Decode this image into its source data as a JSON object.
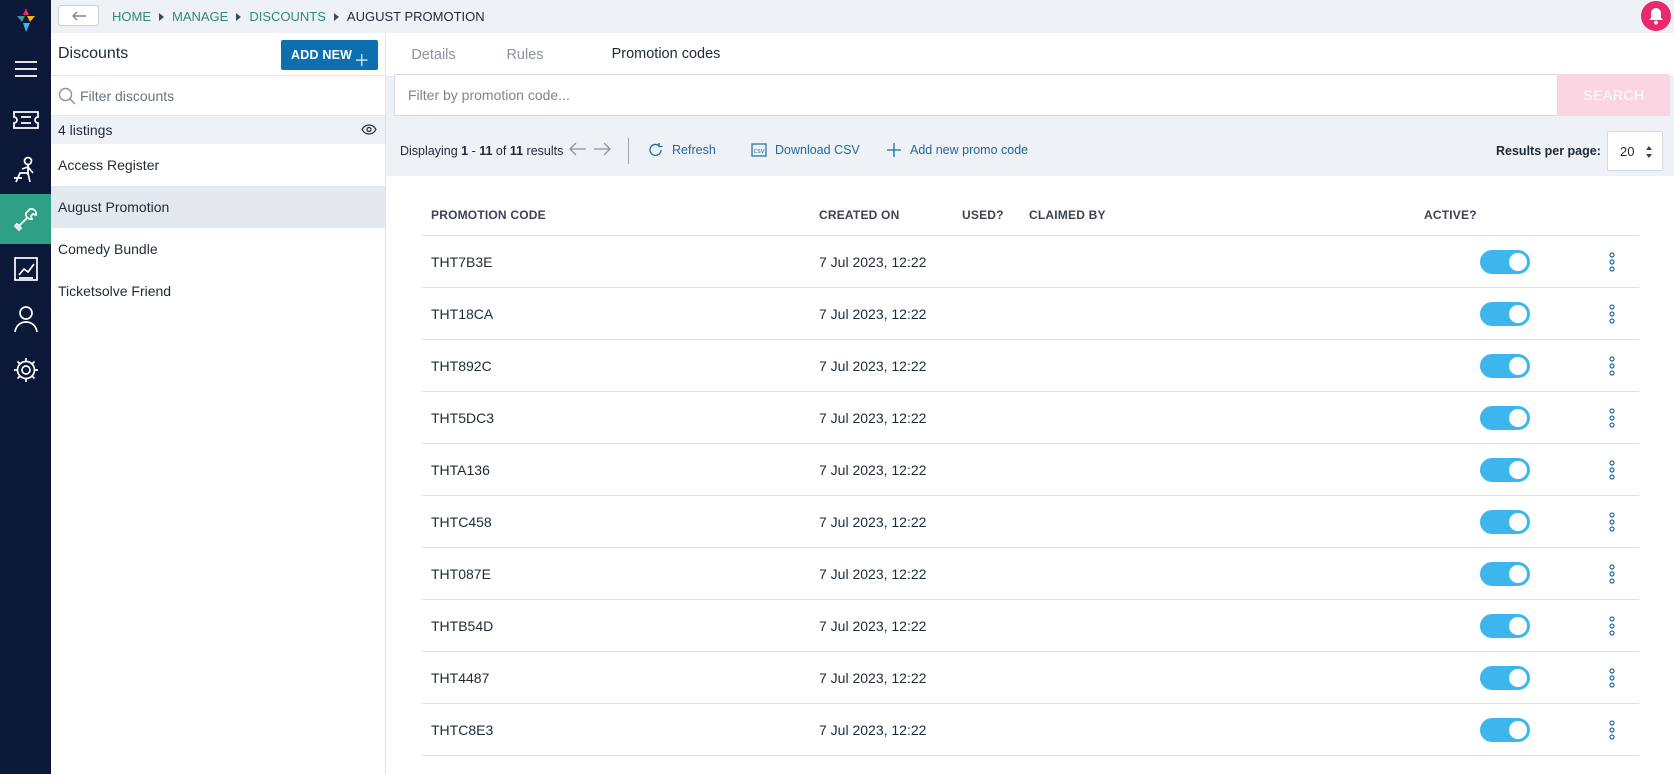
{
  "breadcrumb": [
    {
      "label": "HOME"
    },
    {
      "label": "MANAGE"
    },
    {
      "label": "DISCOUNTS"
    },
    {
      "label": "AUGUST PROMOTION"
    }
  ],
  "sidebar_nav": [
    "menu-icon",
    "ticket-icon",
    "usher-icon",
    "wrench-icon",
    "report-icon",
    "user-icon",
    "gear-icon"
  ],
  "panel": {
    "title": "Discounts",
    "add_new_label": "ADD NEW",
    "filter_placeholder": "Filter discounts",
    "listings_count": "4 listings",
    "items": [
      {
        "label": "Access Register"
      },
      {
        "label": "August Promotion"
      },
      {
        "label": "Comedy Bundle"
      },
      {
        "label": "Ticketsolve Friend"
      }
    ],
    "selected_item": "August Promotion"
  },
  "tabs": [
    {
      "label": "Details"
    },
    {
      "label": "Rules"
    },
    {
      "label": "Promotion codes"
    }
  ],
  "active_tab": "Promotion codes",
  "search": {
    "placeholder": "Filter by promotion code...",
    "button_label": "SEARCH"
  },
  "toolbar": {
    "displaying_prefix": "Displaying",
    "range_start": "1",
    "range_end": "11",
    "of_label": "of",
    "total": "11",
    "results_label": "results",
    "refresh_label": "Refresh",
    "download_label": "Download CSV",
    "add_promo_label": "Add new promo code",
    "rpp_label": "Results per page:",
    "rpp_value": "20"
  },
  "table": {
    "headers": {
      "code": "PROMOTION CODE",
      "created": "CREATED ON",
      "used": "USED?",
      "claimed": "CLAIMED BY",
      "active": "ACTIVE?"
    },
    "rows": [
      {
        "code": "THT7B3E",
        "created": "7 Jul 2023, 12:22",
        "used": "",
        "claimed": "",
        "active": true
      },
      {
        "code": "THT18CA",
        "created": "7 Jul 2023, 12:22",
        "used": "",
        "claimed": "",
        "active": true
      },
      {
        "code": "THT892C",
        "created": "7 Jul 2023, 12:22",
        "used": "",
        "claimed": "",
        "active": true
      },
      {
        "code": "THT5DC3",
        "created": "7 Jul 2023, 12:22",
        "used": "",
        "claimed": "",
        "active": true
      },
      {
        "code": "THTA136",
        "created": "7 Jul 2023, 12:22",
        "used": "",
        "claimed": "",
        "active": true
      },
      {
        "code": "THTC458",
        "created": "7 Jul 2023, 12:22",
        "used": "",
        "claimed": "",
        "active": true
      },
      {
        "code": "THT087E",
        "created": "7 Jul 2023, 12:22",
        "used": "",
        "claimed": "",
        "active": true
      },
      {
        "code": "THTB54D",
        "created": "7 Jul 2023, 12:22",
        "used": "",
        "claimed": "",
        "active": true
      },
      {
        "code": "THT4487",
        "created": "7 Jul 2023, 12:22",
        "used": "",
        "claimed": "",
        "active": true
      },
      {
        "code": "THTC8E3",
        "created": "7 Jul 2023, 12:22",
        "used": "",
        "claimed": "",
        "active": true
      }
    ]
  },
  "colors": {
    "rail_bg": "#0c1838",
    "rail_active": "#2f9f86",
    "primary_button": "#0d6fb0",
    "toggle_on": "#3db6ee",
    "notification": "#e8296b",
    "link": "#1e6aa0"
  }
}
